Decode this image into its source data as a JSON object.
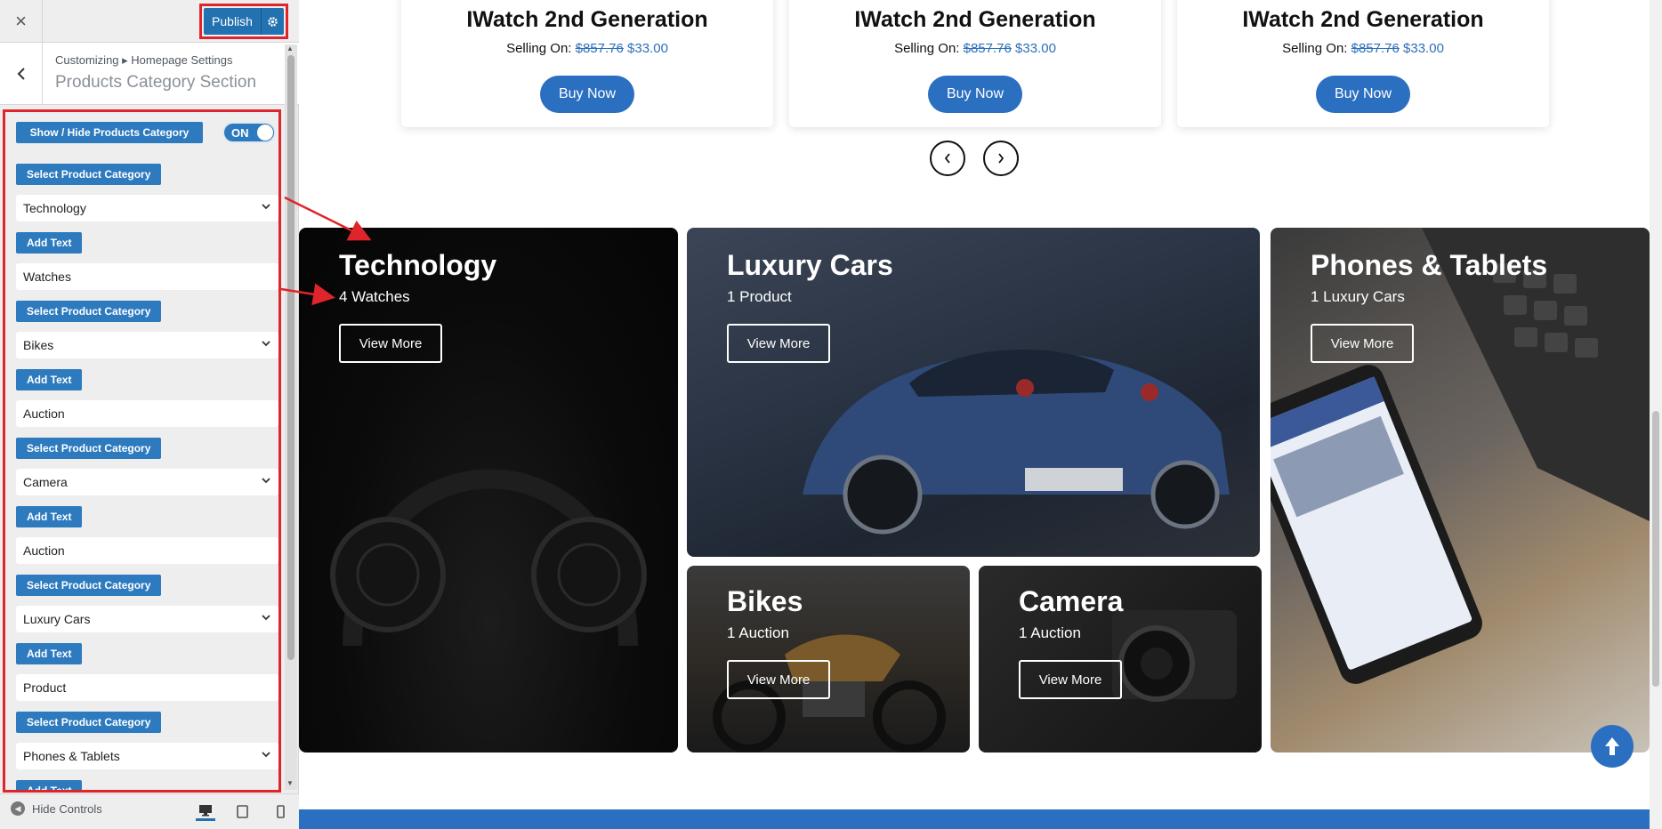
{
  "sidebar": {
    "close_icon": "×",
    "publish_label": "Publish",
    "breadcrumb": "Customizing ▸ Homepage Settings",
    "section_title": "Products Category Section",
    "show_hide_label": "Show / Hide Products Category",
    "toggle_label": "ON",
    "select_category_label": "Select Product Category",
    "add_text_label": "Add Text",
    "categories": [
      {
        "select": "Technology",
        "text": "Watches"
      },
      {
        "select": "Bikes",
        "text": "Auction"
      },
      {
        "select": "Camera",
        "text": "Auction"
      },
      {
        "select": "Luxury Cars",
        "text": "Product"
      },
      {
        "select": "Phones & Tablets",
        "text": ""
      }
    ],
    "hide_controls_label": "Hide Controls",
    "accent_color": "#2271b1"
  },
  "preview": {
    "products": [
      {
        "title": "IWatch 2nd Generation",
        "selling_on": "Selling On:",
        "old_price": "$857.76",
        "new_price": "$33.00",
        "buy_label": "Buy Now"
      },
      {
        "title": "IWatch 2nd Generation",
        "selling_on": "Selling On:",
        "old_price": "$857.76",
        "new_price": "$33.00",
        "buy_label": "Buy Now"
      },
      {
        "title": "IWatch 2nd Generation",
        "selling_on": "Selling On:",
        "old_price": "$857.76",
        "new_price": "$33.00",
        "buy_label": "Buy Now"
      }
    ],
    "prev_icon": "‹",
    "next_icon": "›",
    "tiles": {
      "technology": {
        "title": "Technology",
        "subtitle": "4 Watches",
        "button": "View More"
      },
      "luxury_cars": {
        "title": "Luxury Cars",
        "subtitle": "1 Product",
        "button": "View More"
      },
      "phones": {
        "title": "Phones & Tablets",
        "subtitle": "1 Luxury Cars",
        "button": "View More"
      },
      "bikes": {
        "title": "Bikes",
        "subtitle": "1 Auction",
        "button": "View More"
      },
      "camera": {
        "title": "Camera",
        "subtitle": "1 Auction",
        "button": "View More"
      }
    },
    "scroll_top_icon": "🡑",
    "brand_color": "#2b6fc1",
    "annotation_color": "#e0242b"
  }
}
